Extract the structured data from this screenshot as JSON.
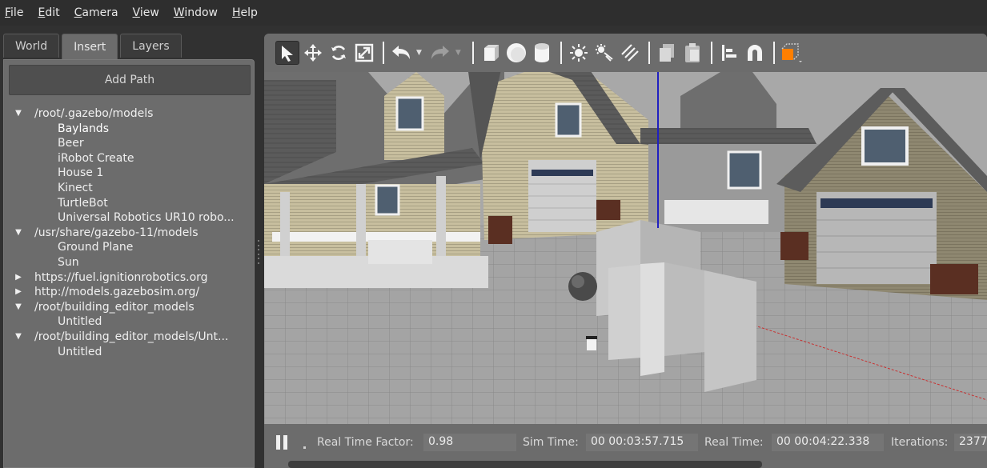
{
  "menu": {
    "items": [
      {
        "label": "File",
        "mnemonic": "F",
        "rest": "ile"
      },
      {
        "label": "Edit",
        "mnemonic": "E",
        "rest": "dit"
      },
      {
        "label": "Camera",
        "mnemonic": "C",
        "rest": "amera"
      },
      {
        "label": "View",
        "mnemonic": "V",
        "rest": "iew"
      },
      {
        "label": "Window",
        "mnemonic": "W",
        "rest": "indow"
      },
      {
        "label": "Help",
        "mnemonic": "H",
        "rest": "elp"
      }
    ]
  },
  "left_panel": {
    "tabs": [
      {
        "label": "World",
        "active": false
      },
      {
        "label": "Insert",
        "active": true
      },
      {
        "label": "Layers",
        "active": false
      }
    ],
    "add_path_label": "Add Path",
    "tree": [
      {
        "type": "root",
        "expanded": true,
        "label": "/root/.gazebo/models"
      },
      {
        "type": "child",
        "label": "Baylands",
        "selected": true
      },
      {
        "type": "child",
        "label": "Beer"
      },
      {
        "type": "child",
        "label": "iRobot Create"
      },
      {
        "type": "child",
        "label": "House 1"
      },
      {
        "type": "child",
        "label": "Kinect"
      },
      {
        "type": "child",
        "label": "TurtleBot"
      },
      {
        "type": "child",
        "label": "Universal Robotics UR10 robo..."
      },
      {
        "type": "root",
        "expanded": true,
        "label": "/usr/share/gazebo-11/models"
      },
      {
        "type": "child",
        "label": "Ground Plane"
      },
      {
        "type": "child",
        "label": "Sun"
      },
      {
        "type": "root",
        "expanded": false,
        "label": "https://fuel.ignitionrobotics.org"
      },
      {
        "type": "root",
        "expanded": false,
        "label": "http://models.gazebosim.org/"
      },
      {
        "type": "root",
        "expanded": true,
        "label": "/root/building_editor_models"
      },
      {
        "type": "child",
        "label": "Untitled"
      },
      {
        "type": "root",
        "expanded": true,
        "label": "/root/building_editor_models/Unt..."
      },
      {
        "type": "child",
        "label": "Untitled"
      }
    ]
  },
  "toolbar": {
    "icons": [
      "select-arrow-icon",
      "translate-icon",
      "rotate-icon",
      "scale-icon",
      "undo-icon",
      "redo-icon",
      "box-icon",
      "sphere-icon",
      "cylinder-icon",
      "point-light-icon",
      "spot-light-icon",
      "directional-light-icon",
      "copy-icon",
      "paste-icon",
      "align-icon",
      "snap-magnet-icon",
      "view-angle-icon"
    ],
    "accent_color": "#ff7f00"
  },
  "status": {
    "real_time_factor_label": "Real Time Factor:",
    "real_time_factor_value": "0.98",
    "sim_time_label": "Sim Time:",
    "sim_time_value": "00 00:03:57.715",
    "real_time_label": "Real Time:",
    "real_time_value": "00 00:04:22.338",
    "iterations_label": "Iterations:",
    "iterations_value": "2377"
  }
}
